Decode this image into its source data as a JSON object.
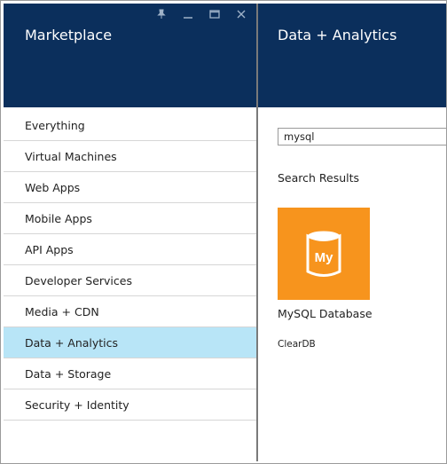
{
  "window": {
    "controls": [
      {
        "name": "pin-icon",
        "glyph": "📌"
      },
      {
        "name": "minimize-icon",
        "glyph": "—"
      },
      {
        "name": "maximize-icon",
        "glyph": "☐"
      },
      {
        "name": "close-icon",
        "glyph": "✕"
      }
    ]
  },
  "marketplace": {
    "title": "Marketplace",
    "categories": [
      {
        "label": "Everything"
      },
      {
        "label": "Virtual Machines"
      },
      {
        "label": "Web Apps"
      },
      {
        "label": "Mobile Apps"
      },
      {
        "label": "API Apps"
      },
      {
        "label": "Developer Services"
      },
      {
        "label": "Media + CDN"
      },
      {
        "label": "Data + Analytics",
        "selected": true
      },
      {
        "label": "Data + Storage"
      },
      {
        "label": "Security + Identity"
      }
    ]
  },
  "detail": {
    "title": "Data + Analytics",
    "search": {
      "value": "mysql"
    },
    "results_heading": "Search Results",
    "result": {
      "title": "MySQL Database",
      "publisher": "ClearDB",
      "icon_label": "My",
      "icon": "database-icon",
      "tile_color": "#f7941d"
    }
  },
  "colors": {
    "header_bg": "#0b2f5c",
    "selected_bg": "#b8e5f7"
  }
}
